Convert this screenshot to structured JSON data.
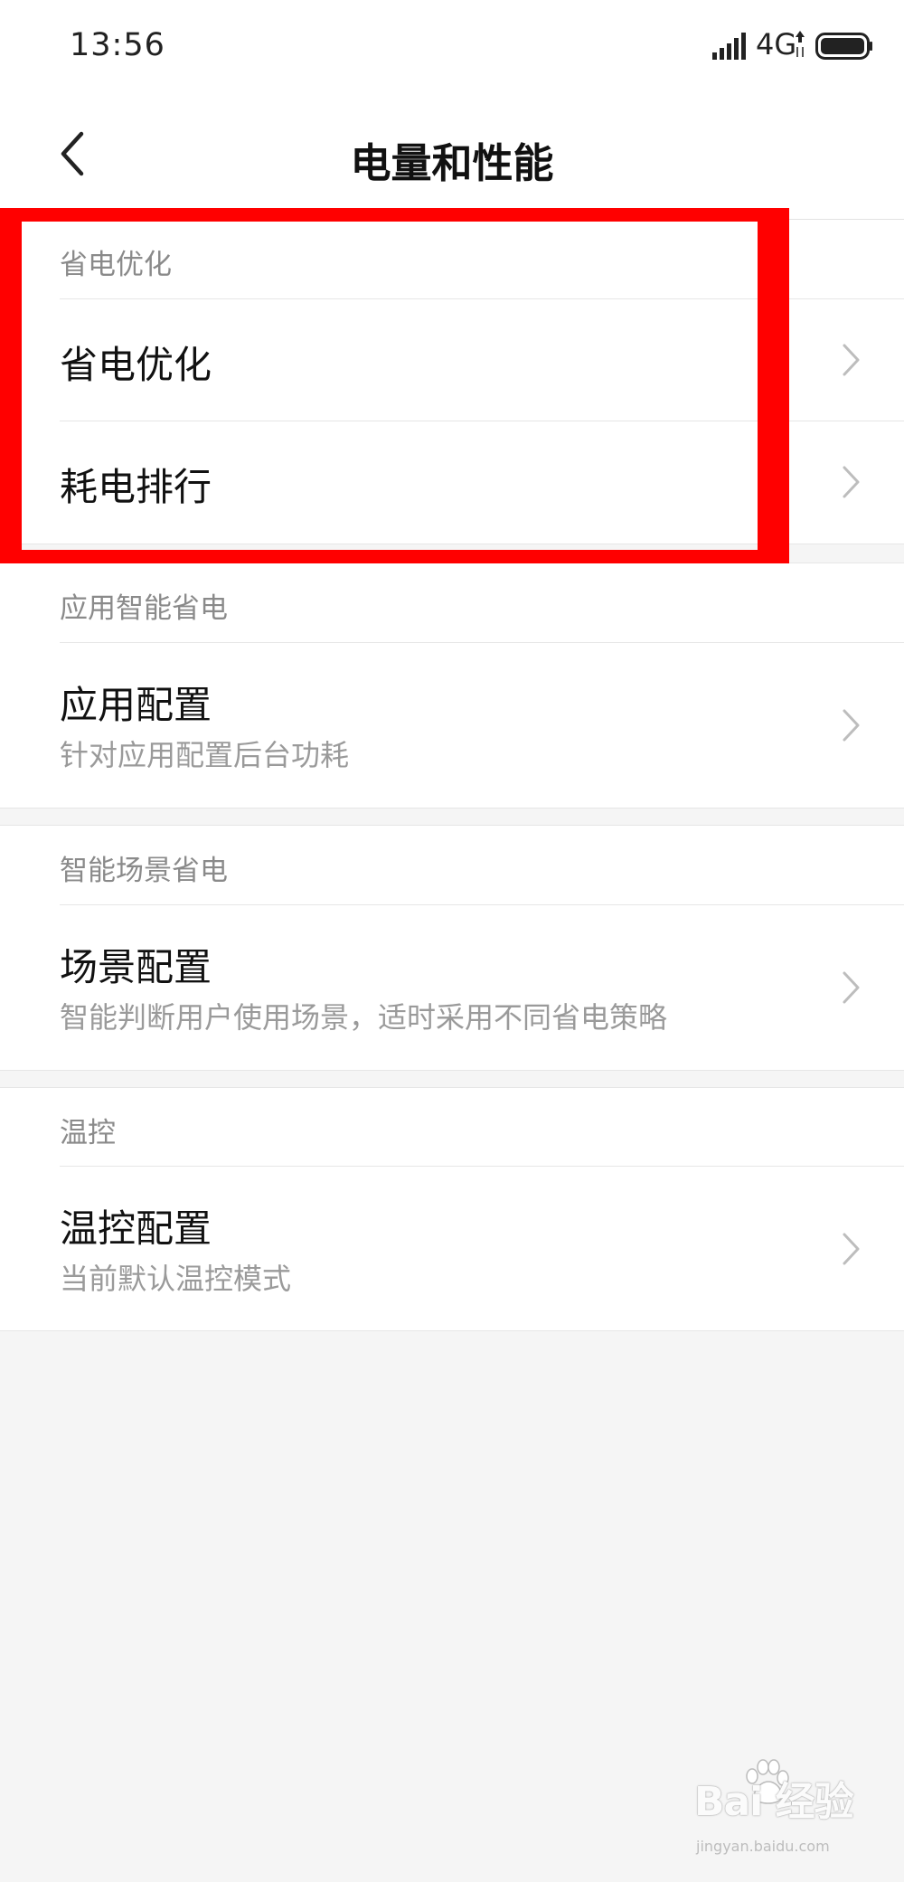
{
  "status_bar": {
    "time": "13:56",
    "network": "4G",
    "icons": [
      "signal-icon",
      "network-arrows-icon",
      "battery-icon"
    ]
  },
  "header": {
    "title": "电量和性能",
    "back_icon": "chevron-left-icon"
  },
  "sections": [
    {
      "header": "省电优化",
      "items": [
        {
          "title": "省电优化"
        },
        {
          "title": "耗电排行"
        }
      ]
    },
    {
      "header": "应用智能省电",
      "items": [
        {
          "title": "应用配置",
          "subtitle": "针对应用配置后台功耗"
        }
      ]
    },
    {
      "header": "智能场景省电",
      "items": [
        {
          "title": "场景配置",
          "subtitle": "智能判断用户使用场景，适时采用不同省电策略"
        }
      ]
    },
    {
      "header": "温控",
      "items": [
        {
          "title": "温控配置",
          "subtitle": "当前默认温控模式"
        }
      ]
    }
  ],
  "annotation": {
    "highlight_color": "#ff0000"
  },
  "watermark": {
    "brand": "Bai  经验",
    "url": "jingyan.baidu.com"
  },
  "colors": {
    "background": "#f5f5f5",
    "surface": "#ffffff",
    "secondary_text": "#8a8a8a",
    "chevron": "#bdbdbd"
  }
}
